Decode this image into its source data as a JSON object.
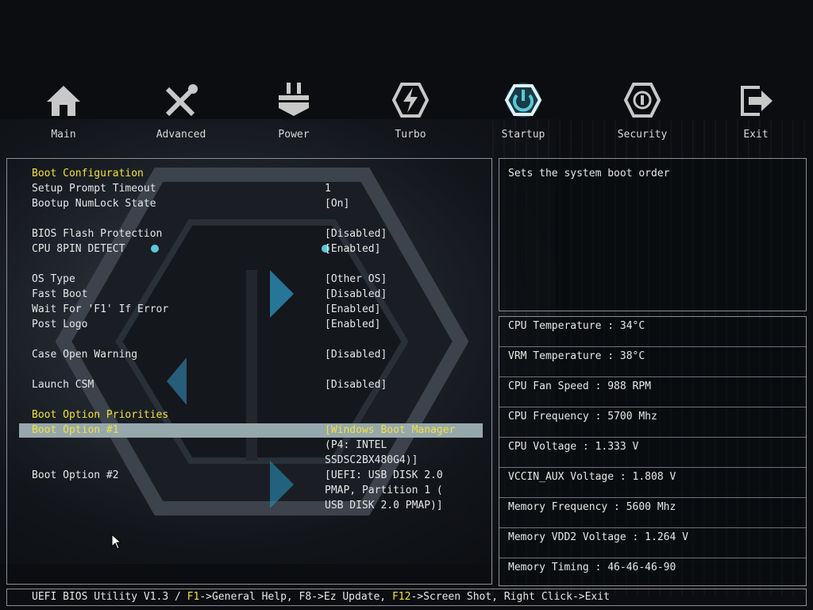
{
  "nav": [
    {
      "label": "Main",
      "icon": "home-icon"
    },
    {
      "label": "Advanced",
      "icon": "tools-icon"
    },
    {
      "label": "Power",
      "icon": "power-plug-icon"
    },
    {
      "label": "Turbo",
      "icon": "lightning-icon"
    },
    {
      "label": "Startup",
      "icon": "power-button-icon",
      "active": true
    },
    {
      "label": "Security",
      "icon": "shield-icon"
    },
    {
      "label": "Exit",
      "icon": "exit-icon"
    }
  ],
  "settings": {
    "boot_config_header": "Boot Configuration",
    "setup_prompt_timeout": {
      "label": "Setup Prompt Timeout",
      "value": "1"
    },
    "bootup_numlock": {
      "label": "Bootup NumLock State",
      "value": "[On]"
    },
    "bios_flash_protection": {
      "label": "BIOS Flash Protection",
      "value": "[Disabled]"
    },
    "cpu_8pin_detect": {
      "label": "CPU 8PIN DETECT",
      "value": "[Enabled]"
    },
    "os_type": {
      "label": "OS Type",
      "value": "[Other OS]"
    },
    "fast_boot": {
      "label": "Fast Boot",
      "value": "[Disabled]"
    },
    "wait_f1": {
      "label": "Wait For 'F1' If Error",
      "value": "[Enabled]"
    },
    "post_logo": {
      "label": "Post Logo",
      "value": "[Enabled]"
    },
    "case_open_warning": {
      "label": "Case Open Warning",
      "value": "[Disabled]"
    },
    "launch_csm": {
      "label": "Launch CSM",
      "value": "[Disabled]"
    },
    "boot_priorities_header": "Boot Option Priorities",
    "boot_option_1": {
      "label": "Boot Option #1",
      "value_lines": [
        "[Windows Boot Manager",
        "(P4: INTEL",
        "SSDSC2BX480G4)]"
      ]
    },
    "boot_option_2": {
      "label": "Boot Option #2",
      "value_lines": [
        "[UEFI:  USB DISK 2.0",
        "PMAP, Partition 1 (",
        "USB DISK 2.0 PMAP)]"
      ]
    }
  },
  "help": "Sets the system boot order",
  "hardware": [
    "CPU Temperature : 34°C",
    "VRM Temperature : 38°C",
    "CPU Fan Speed : 988 RPM",
    "CPU Frequency : 5700 Mhz",
    "CPU Voltage : 1.333 V",
    "VCCIN_AUX Voltage : 1.808 V",
    "Memory Frequency : 5600 Mhz",
    "Memory VDD2 Voltage : 1.264 V",
    "Memory Timing : 46-46-46-90"
  ],
  "status_bar": {
    "prefix": "UEFI BIOS Utility V1.3 / ",
    "f1": "F1",
    "f1_text": "->General Help, F8->Ez Update, ",
    "f12": "F12",
    "f12_text": "->Screen Shot, Right Click->Exit"
  },
  "colors": {
    "accent": "#f0e040",
    "highlight": "#96a8ac",
    "active_icon": "#5ac8d8"
  }
}
